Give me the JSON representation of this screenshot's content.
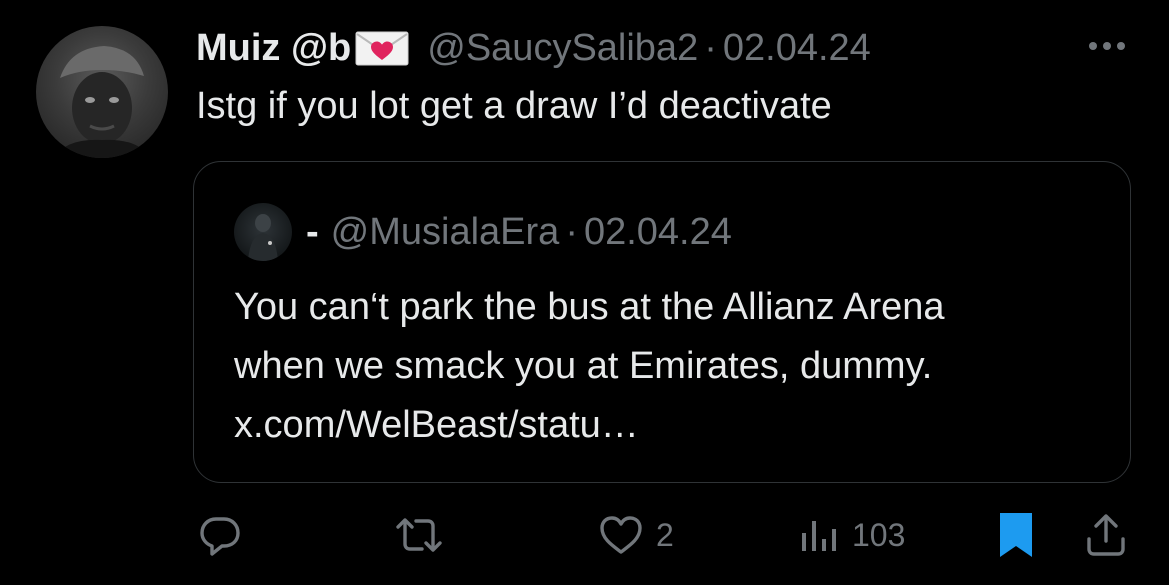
{
  "tweet": {
    "author_name": "Muiz @b",
    "author_handle": "@SaucySaliba2",
    "separator": "·",
    "date": "02.04.24",
    "text": "Istg if you lot get a draw I’d deactivate",
    "name_emoji_icon": "love-letter-icon",
    "avatar_icon": "profile-photo"
  },
  "quoted_tweet": {
    "author_name": "-",
    "author_handle": "@MusialaEra",
    "separator": "·",
    "date": "02.04.24",
    "text_lines": [
      "You can‘t park the bus at the Allianz Arena",
      "when we smack you at Emirates, dummy.",
      "x.com/WelBeast/statu…"
    ],
    "avatar_icon": "profile-photo"
  },
  "actions": {
    "reply_icon": "reply-icon",
    "retweet_icon": "retweet-icon",
    "like_icon": "heart-icon",
    "like_count": "2",
    "views_icon": "views-icon",
    "view_count": "103",
    "bookmark_icon": "bookmark-icon",
    "share_icon": "share-icon"
  },
  "colors": {
    "background": "#000000",
    "primary_text": "#e7e9ea",
    "secondary_text": "#71767b",
    "card_border": "#2f3336",
    "bookmark_active": "#1d9bf0"
  }
}
